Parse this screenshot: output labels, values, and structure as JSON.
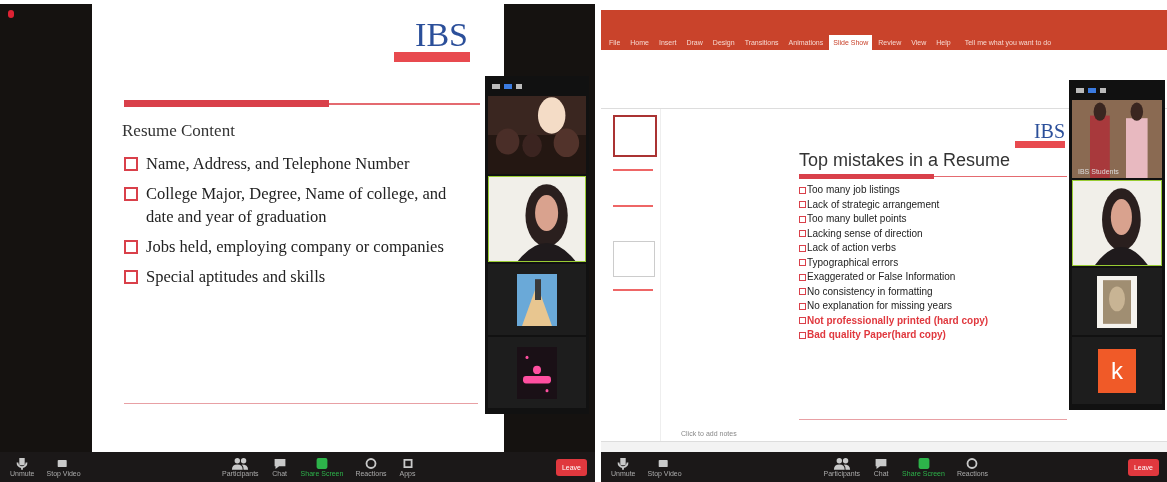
{
  "left_screen": {
    "slide": {
      "logo": "IBS",
      "title": "Resume Content",
      "bullets": [
        {
          "text": "Name, Address, and Telephone Number"
        },
        {
          "text": "College Major, Degree, Name of college, and date and year of graduation"
        },
        {
          "text": "Jobs held, employing company or companies"
        },
        {
          "text": "Special aptitudes and skills"
        }
      ]
    },
    "video_tiles": [
      {
        "kind": "crowd"
      },
      {
        "kind": "person"
      },
      {
        "kind": "poster"
      },
      {
        "kind": "sticker"
      }
    ],
    "toolbar": [
      {
        "kind": "mic",
        "label": "Unmute"
      },
      {
        "kind": "video",
        "label": "Stop Video"
      },
      {
        "kind": "spacer"
      },
      {
        "kind": "participants",
        "label": "Participants"
      },
      {
        "kind": "chat",
        "label": "Chat"
      },
      {
        "kind": "share",
        "label": "Share Screen"
      },
      {
        "kind": "reactions",
        "label": "Reactions"
      },
      {
        "kind": "apps",
        "label": "Apps"
      },
      {
        "kind": "spacer"
      },
      {
        "kind": "leave",
        "label": "Leave"
      }
    ]
  },
  "right_screen": {
    "ribbon_tabs": [
      {
        "label": "File",
        "selected": false
      },
      {
        "label": "Home",
        "selected": false
      },
      {
        "label": "Insert",
        "selected": false
      },
      {
        "label": "Draw",
        "selected": false
      },
      {
        "label": "Design",
        "selected": false
      },
      {
        "label": "Transitions",
        "selected": false
      },
      {
        "label": "Animations",
        "selected": false
      },
      {
        "label": "Slide Show",
        "selected": true
      },
      {
        "label": "Review",
        "selected": false
      },
      {
        "label": "View",
        "selected": false
      },
      {
        "label": "Help",
        "selected": false
      }
    ],
    "tell_me": "Tell me what you want to do",
    "slide": {
      "logo": "IBS",
      "title": "Top mistakes in a Resume",
      "bullets": [
        {
          "text": "Too many job listings",
          "emphasis": false
        },
        {
          "text": "Lack of strategic arrangement",
          "emphasis": false
        },
        {
          "text": "Too many bullet points",
          "emphasis": false
        },
        {
          "text": "Lacking sense of direction",
          "emphasis": false
        },
        {
          "text": "Lack of action verbs",
          "emphasis": false
        },
        {
          "text": "Typographical errors",
          "emphasis": false
        },
        {
          "text": "Exaggerated or False Information",
          "emphasis": false
        },
        {
          "text": "No consistency in formatting",
          "emphasis": false
        },
        {
          "text": "No explanation for missing years",
          "emphasis": false
        },
        {
          "text": "Not professionally printed (hard copy)",
          "emphasis": true
        },
        {
          "text": "Bad quality Paper(hard copy)",
          "emphasis": true
        }
      ]
    },
    "notes_placeholder": "Click to add notes",
    "video_tiles": [
      {
        "kind": "crowd",
        "name": "IBS Students"
      },
      {
        "kind": "person"
      },
      {
        "kind": "poster"
      },
      {
        "kind": "letter",
        "letter": "k"
      }
    ],
    "toolbar": [
      {
        "kind": "mic",
        "label": "Unmute"
      },
      {
        "kind": "video",
        "label": "Stop Video"
      },
      {
        "kind": "spacer"
      },
      {
        "kind": "participants",
        "label": "Participants"
      },
      {
        "kind": "chat",
        "label": "Chat"
      },
      {
        "kind": "share",
        "label": "Share Screen"
      },
      {
        "kind": "reactions",
        "label": "Reactions"
      },
      {
        "kind": "spacer"
      },
      {
        "kind": "leave",
        "label": "Leave"
      }
    ]
  }
}
